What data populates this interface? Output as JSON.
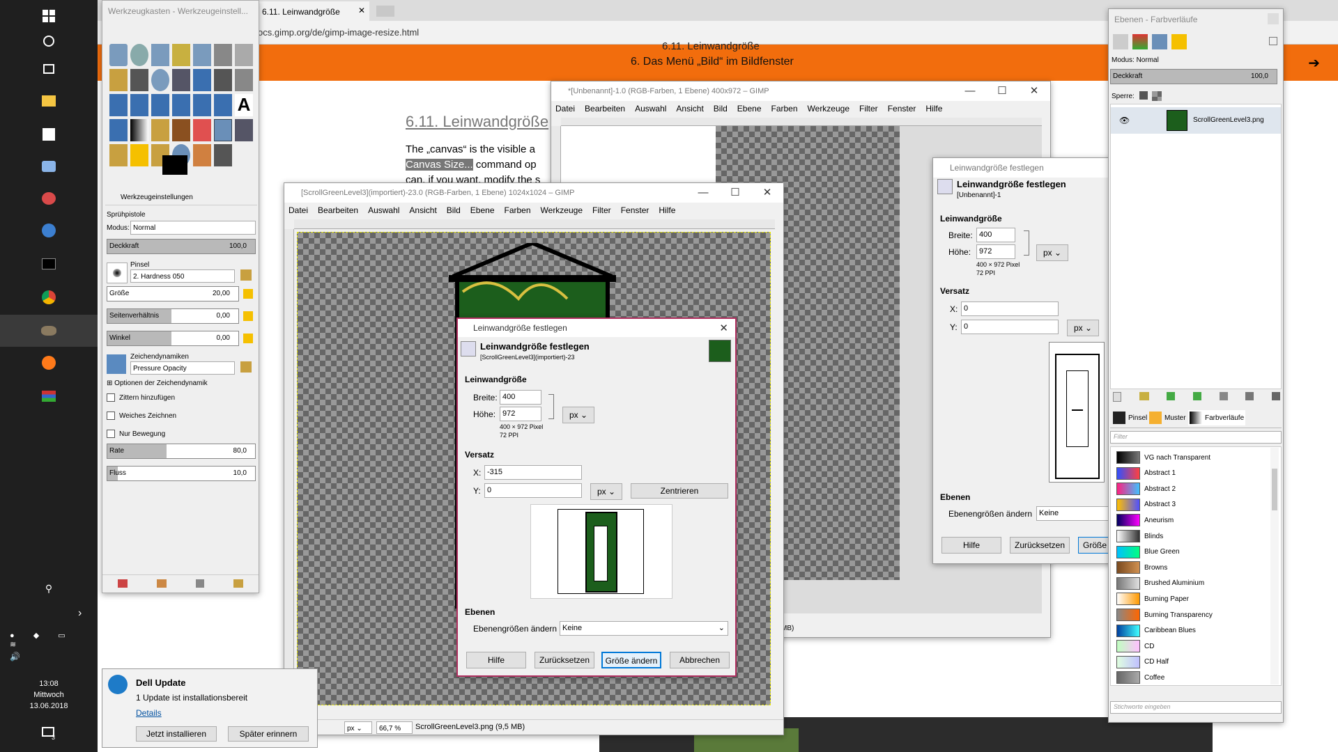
{
  "taskbar": {
    "time": "13:08",
    "day": "Mittwoch",
    "date": "13.06.2018",
    "notif_count": "3"
  },
  "browser": {
    "tab_title": "6.11. Leinwandgröße",
    "url": "ocs.gimp.org/de/gimp-image-resize.html",
    "banner_top": "6.11. Leinwandgröße",
    "banner": "6. Das Menü „Bild“ im Bildfenster",
    "heading": "6.11. Leinwandgröße",
    "line1": "The „canvas“ is the visible a",
    "line2_hl": "Canvas Size...",
    "line2": " command op",
    "line3": "can, if you want, modify the s"
  },
  "toolbox": {
    "title": "Werkzeugkasten - Werkzeugeinstell...",
    "tab": "Werkzeugeinstellungen",
    "tool": "Sprühpistole",
    "modus_label": "Modus:",
    "modus_value": "Normal",
    "deckkraft": "Deckkraft",
    "deckkraft_value": "100,0",
    "pinsel_label": "Pinsel",
    "pinsel_value": "2. Hardness 050",
    "groesse": "Größe",
    "groesse_value": "20,00",
    "seiten": "Seitenverhältnis",
    "seiten_value": "0,00",
    "winkel": "Winkel",
    "winkel_value": "0,00",
    "dyn_label": "Zeichendynamiken",
    "dyn_value": "Pressure Opacity",
    "dyn_opt": "Optionen der Zeichendynamik",
    "cb1": "Zittern hinzufügen",
    "cb2": "Weiches Zeichnen",
    "cb3": "Nur Bewegung",
    "rate": "Rate",
    "rate_value": "80,0",
    "fluss": "Fluss",
    "fluss_value": "10,0",
    "rate_pct": 0.4,
    "fluss_pct": 0.07
  },
  "gimp2": {
    "title": "*[Unbenannt]-1.0 (RGB-Farben, 1 Ebene) 400x972 – GIMP",
    "status": "MB)"
  },
  "gimp1": {
    "title": "[ScrollGreenLevel3](importiert)-23.0 (RGB-Farben, 1 Ebene) 1024x1024 – GIMP",
    "unit": "px",
    "zoom": "66,7 %",
    "status": "ScrollGreenLevel3.png (9,5 MB)"
  },
  "menus": [
    "Datei",
    "Bearbeiten",
    "Auswahl",
    "Ansicht",
    "Bild",
    "Ebene",
    "Farben",
    "Werkzeuge",
    "Filter",
    "Fenster",
    "Hilfe"
  ],
  "dialog": {
    "title": "Leinwandgröße festlegen",
    "header": "Leinwandgröße festlegen",
    "subheader": "[ScrollGreenLevel3](importiert)-23",
    "section_size": "Leinwandgröße",
    "breite": "Breite:",
    "breite_value": "400",
    "hoehe": "Höhe:",
    "hoehe_value": "972",
    "info1": "400 × 972 Pixel",
    "info2": "72 PPI",
    "unit": "px",
    "section_offset": "Versatz",
    "x": "X:",
    "x_value": "-315",
    "y": "Y:",
    "y_value": "0",
    "offset_unit": "px",
    "center": "Zentrieren",
    "section_layers": "Ebenen",
    "layers_label": "Ebenengrößen ändern",
    "layers_value": "Keine",
    "help": "Hilfe",
    "reset": "Zurücksetzen",
    "resize": "Größe ändern",
    "cancel": "Abbrechen"
  },
  "dialog2": {
    "title": "Leinwandgröße festlegen",
    "header": "Leinwandgröße festlegen",
    "subheader": "[Unbenannt]-1",
    "section_size": "Leinwandgröße",
    "breite": "Breite:",
    "breite_value": "400",
    "hoehe": "Höhe:",
    "hoehe_value": "972",
    "info1": "400 × 972 Pixel",
    "info2": "72 PPI",
    "unit": "px",
    "section_offset": "Versatz",
    "x": "X:",
    "x_value": "0",
    "y": "Y:",
    "y_value": "0",
    "offset_unit": "px",
    "section_layers": "Ebenen",
    "layers_label": "Ebenengrößen ändern",
    "layers_value": "Keine",
    "help": "Hilfe",
    "reset": "Zurücksetzen",
    "resize": "Größe"
  },
  "layers": {
    "title": "Ebenen - Farbverläufe",
    "modus_label": "Modus:",
    "modus_value": "Normal",
    "deckkraft": "Deckkraft",
    "deckkraft_value": "100,0",
    "sperre": "Sperre:",
    "layer_name": "ScrollGreenLevel3.png",
    "tab_pinsel": "Pinsel",
    "tab_muster": "Muster",
    "tab_farbverlaeufe": "Farbverläufe",
    "filter_placeholder": "Filter",
    "tags_placeholder": "Stichworte eingeben",
    "gradients": [
      {
        "name": "VG nach Transparent",
        "c1": "#000000",
        "c2": "#777777"
      },
      {
        "name": "Abstract 1",
        "c1": "#3050ff",
        "c2": "#ff4040"
      },
      {
        "name": "Abstract 2",
        "c1": "#ff2080",
        "c2": "#40c0ff"
      },
      {
        "name": "Abstract 3",
        "c1": "#ffc000",
        "c2": "#5050ff"
      },
      {
        "name": "Aneurism",
        "c1": "#000060",
        "c2": "#ff00ff"
      },
      {
        "name": "Blinds",
        "c1": "#ffffff",
        "c2": "#333333"
      },
      {
        "name": "Blue Green",
        "c1": "#00c0ff",
        "c2": "#00ff80"
      },
      {
        "name": "Browns",
        "c1": "#7a4a20",
        "c2": "#d09050"
      },
      {
        "name": "Brushed Aluminium",
        "c1": "#777777",
        "c2": "#e0e0e0"
      },
      {
        "name": "Burning Paper",
        "c1": "#ffffff",
        "c2": "#ff9900"
      },
      {
        "name": "Burning Transparency",
        "c1": "#888888",
        "c2": "#ff6600"
      },
      {
        "name": "Caribbean Blues",
        "c1": "#0040a0",
        "c2": "#40ffff"
      },
      {
        "name": "CD",
        "c1": "#c0ffc0",
        "c2": "#ffc0ff"
      },
      {
        "name": "CD Half",
        "c1": "#e0ffe0",
        "c2": "#c0c0ff"
      },
      {
        "name": "Coffee",
        "c1": "#666666",
        "c2": "#aaaaaa"
      }
    ]
  },
  "dell": {
    "title": "Dell Update",
    "message": "1 Update ist installationsbereit",
    "details": "Details",
    "install": "Jetzt installieren",
    "later": "Später erinnern"
  }
}
